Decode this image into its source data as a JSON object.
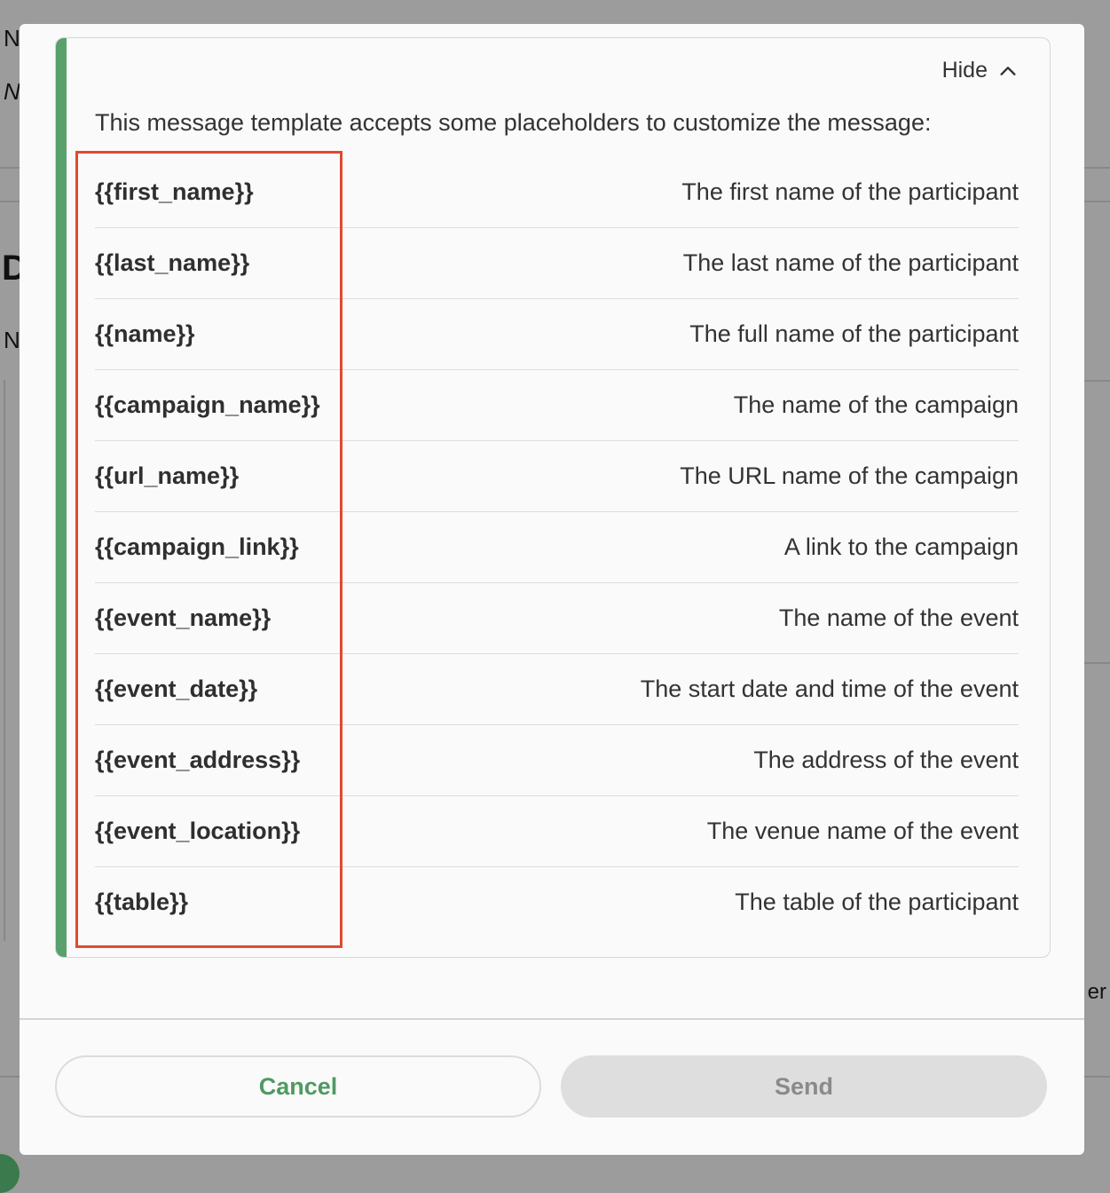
{
  "background": {
    "letters": [
      "N",
      "N",
      "D",
      "N"
    ],
    "fragment": "er"
  },
  "panel": {
    "hide_label": "Hide",
    "toggle_icon": "chevron-up-icon",
    "intro": "This message template accepts some placeholders to customize the message:",
    "placeholders": [
      {
        "key": "{{first_name}}",
        "desc": "The first name of the participant"
      },
      {
        "key": "{{last_name}}",
        "desc": "The last name of the participant"
      },
      {
        "key": "{{name}}",
        "desc": "The full name of the participant"
      },
      {
        "key": "{{campaign_name}}",
        "desc": "The name of the campaign"
      },
      {
        "key": "{{url_name}}",
        "desc": "The URL name of the campaign"
      },
      {
        "key": "{{campaign_link}}",
        "desc": "A link to the campaign"
      },
      {
        "key": "{{event_name}}",
        "desc": "The name of the event"
      },
      {
        "key": "{{event_date}}",
        "desc": "The start date and time of the event"
      },
      {
        "key": "{{event_address}}",
        "desc": "The address of the event"
      },
      {
        "key": "{{event_location}}",
        "desc": "The venue name of the event"
      },
      {
        "key": "{{table}}",
        "desc": "The table of the participant"
      }
    ]
  },
  "footer": {
    "cancel_label": "Cancel",
    "send_label": "Send"
  },
  "colors": {
    "accent": "#5aa06c",
    "highlight": "#e04a2e",
    "cancel_text": "#4e9a62",
    "send_disabled_bg": "#dedede"
  }
}
